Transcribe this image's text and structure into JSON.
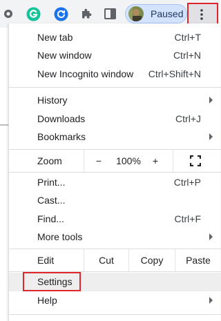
{
  "toolbar": {
    "profile_status": "Paused",
    "icons": [
      "extension-dot-icon",
      "grammarly-icon",
      "refresh-extension-icon",
      "puzzle-icon",
      "side-panel-icon",
      "more-menu-icon"
    ]
  },
  "menu": {
    "group1": [
      {
        "label": "New tab",
        "shortcut": "Ctrl+T"
      },
      {
        "label": "New window",
        "shortcut": "Ctrl+N"
      },
      {
        "label": "New Incognito window",
        "shortcut": "Ctrl+Shift+N"
      }
    ],
    "group2": [
      {
        "label": "History",
        "has_submenu": true
      },
      {
        "label": "Downloads",
        "shortcut": "Ctrl+J"
      },
      {
        "label": "Bookmarks",
        "has_submenu": true
      }
    ],
    "zoom": {
      "label": "Zoom",
      "minus": "−",
      "value": "100%",
      "plus": "+"
    },
    "group3": [
      {
        "label": "Print...",
        "shortcut": "Ctrl+P"
      },
      {
        "label": "Cast..."
      },
      {
        "label": "Find...",
        "shortcut": "Ctrl+F"
      },
      {
        "label": "More tools",
        "has_submenu": true
      }
    ],
    "edit": {
      "label": "Edit",
      "cut": "Cut",
      "copy": "Copy",
      "paste": "Paste"
    },
    "group4": [
      {
        "label": "Settings",
        "highlighted": true
      },
      {
        "label": "Help",
        "has_submenu": true
      }
    ]
  },
  "colors": {
    "toolbar_bg": "#f1f3f4",
    "highlight_box": "#e0262d",
    "chip_bg": "#d3e3fd",
    "grammarly_green": "#15c39a",
    "extension_blue": "#1a73e8"
  }
}
